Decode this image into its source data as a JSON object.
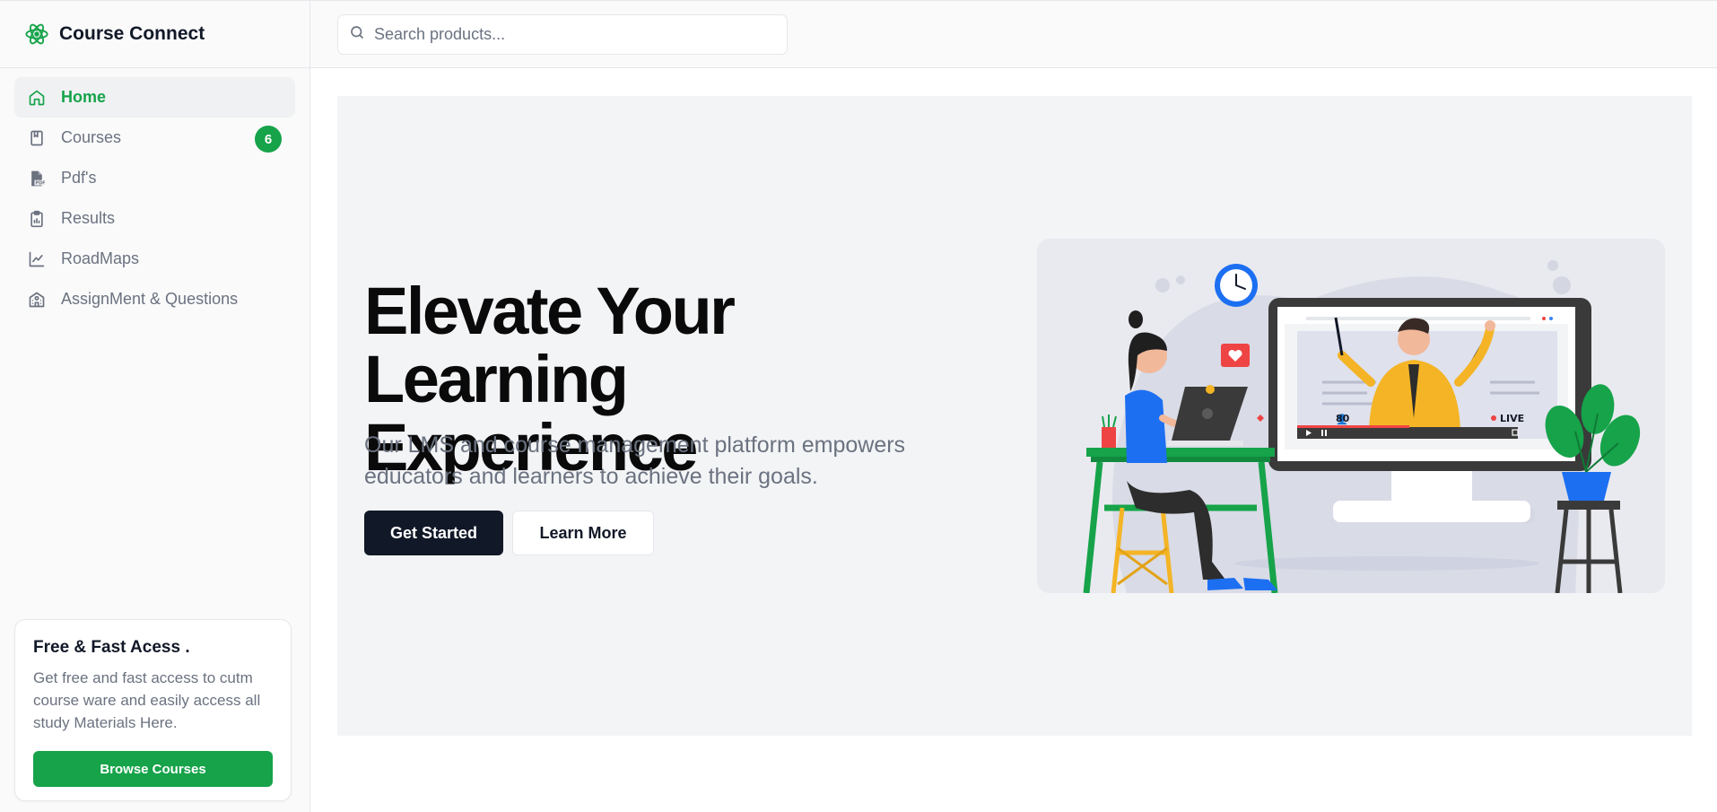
{
  "brand": {
    "name": "Course Connect",
    "accent": "#16a34a"
  },
  "sidebar": {
    "items": [
      {
        "label": "Home",
        "icon": "home-icon",
        "active": true
      },
      {
        "label": "Courses",
        "icon": "book-icon",
        "badge": "6"
      },
      {
        "label": "Pdf's",
        "icon": "pdf-file-icon"
      },
      {
        "label": "Results",
        "icon": "clipboard-icon"
      },
      {
        "label": "RoadMaps",
        "icon": "line-chart-icon"
      },
      {
        "label": "AssignMent & Questions",
        "icon": "school-icon"
      }
    ],
    "promo": {
      "title": "Free & Fast Acess .",
      "text": "Get free and fast access to cutm course ware and easily access all study Materials Here.",
      "button": "Browse Courses"
    }
  },
  "header": {
    "search": {
      "placeholder": "Search products...",
      "value": ""
    }
  },
  "hero": {
    "title_line1": "Elevate Your",
    "title_line2": "Learning Experience",
    "subtitle": "Our LMS and course management platform empowers educators and learners to achieve their goals.",
    "primary_button": "Get Started",
    "secondary_button": "Learn More",
    "illustration": {
      "viewer_count": "80",
      "live_label": "LIVE"
    }
  }
}
